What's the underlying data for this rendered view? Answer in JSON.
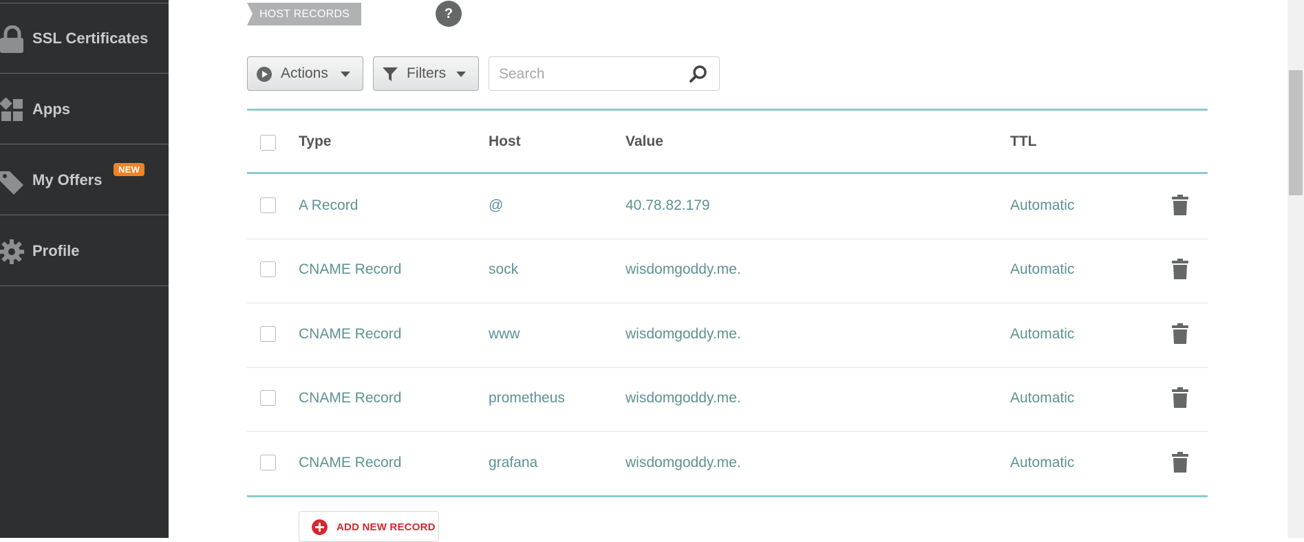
{
  "sidebar": {
    "items": [
      {
        "label": "SSL Certificates",
        "icon": "lock-icon"
      },
      {
        "label": "Apps",
        "icon": "apps-icon"
      },
      {
        "label": "My Offers",
        "icon": "tag-icon",
        "badge": "NEW"
      },
      {
        "label": "Profile",
        "icon": "gear-icon"
      }
    ]
  },
  "section": {
    "title": "HOST RECORDS",
    "help": "?"
  },
  "toolbar": {
    "actions_label": "Actions",
    "filters_label": "Filters",
    "search_placeholder": "Search"
  },
  "table": {
    "headers": {
      "type": "Type",
      "host": "Host",
      "value": "Value",
      "ttl": "TTL"
    },
    "rows": [
      {
        "type": "A Record",
        "host": "@",
        "value": "40.78.82.179",
        "ttl": "Automatic"
      },
      {
        "type": "CNAME Record",
        "host": "sock",
        "value": "wisdomgoddy.me.",
        "ttl": "Automatic"
      },
      {
        "type": "CNAME Record",
        "host": "www",
        "value": "wisdomgoddy.me.",
        "ttl": "Automatic"
      },
      {
        "type": "CNAME Record",
        "host": "prometheus",
        "value": "wisdomgoddy.me.",
        "ttl": "Automatic"
      },
      {
        "type": "CNAME Record",
        "host": "grafana",
        "value": "wisdomgoddy.me.",
        "ttl": "Automatic"
      }
    ]
  },
  "add_record_label": "ADD NEW RECORD",
  "colors": {
    "sidebar_bg": "#2e2f30",
    "accent_teal": "#8fc9cc",
    "cell_text": "#5e9295",
    "badge_orange": "#f58220",
    "add_red": "#d6262f"
  }
}
